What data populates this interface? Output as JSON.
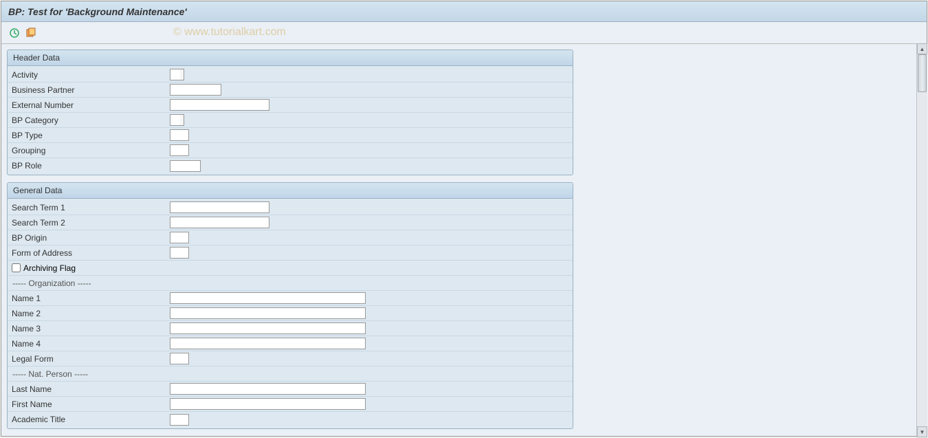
{
  "app_title": "BP: Test for 'Background Maintenance'",
  "watermark": "© www.tutorialkart.com",
  "toolbar": {
    "execute_icon": "execute",
    "variant_icon": "variant"
  },
  "groups": {
    "header": {
      "title": "Header Data",
      "activity": "Activity",
      "business_partner": "Business Partner",
      "external_number": "External Number",
      "bp_category": "BP Category",
      "bp_type": "BP Type",
      "grouping": "Grouping",
      "bp_role": "BP Role"
    },
    "general": {
      "title": "General Data",
      "search_term_1": "Search Term 1",
      "search_term_2": "Search Term 2",
      "bp_origin": "BP Origin",
      "form_of_address": "Form of Address",
      "archiving_flag": "Archiving Flag",
      "org_separator": "----- Organization -----",
      "name_1": "Name 1",
      "name_2": "Name 2",
      "name_3": "Name 3",
      "name_4": "Name 4",
      "legal_form": "Legal Form",
      "person_separator": "----- Nat. Person  -----",
      "last_name": "Last Name",
      "first_name": "First Name",
      "academic_title": "Academic Title"
    }
  }
}
